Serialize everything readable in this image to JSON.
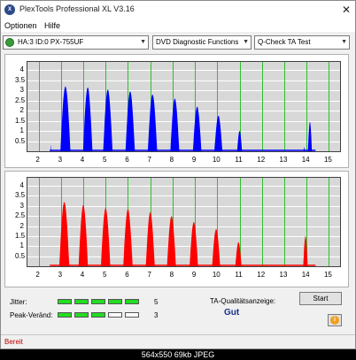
{
  "window": {
    "title": "PlexTools Professional XL V3.16",
    "close_glyph": "✕",
    "icon_text": "X"
  },
  "menu": {
    "items": [
      "Optionen",
      "Hilfe"
    ]
  },
  "toolbar": {
    "drive": "HA:3 ID:0  PX-755UF",
    "function": "DVD Diagnostic Functions",
    "test": "Q-Check TA Test",
    "arrow": "▼"
  },
  "chart_data": [
    {
      "type": "bar",
      "name": "upper",
      "color": "#0000ff",
      "x_ticks": [
        2,
        3,
        4,
        5,
        6,
        7,
        8,
        9,
        10,
        11,
        12,
        13,
        14,
        15
      ],
      "y_ticks": [
        "0.5",
        "1",
        "1.5",
        "2",
        "2.5",
        "3",
        "3.5",
        "4"
      ],
      "xlim": [
        1.5,
        15.5
      ],
      "ylim": [
        0,
        4.4
      ],
      "peaks": [
        {
          "x": 2.55,
          "y": 0.3,
          "w": 0.03
        },
        {
          "x": 3.2,
          "y": 3.2,
          "w": 0.45
        },
        {
          "x": 4.2,
          "y": 3.15,
          "w": 0.42
        },
        {
          "x": 5.1,
          "y": 3.05,
          "w": 0.42
        },
        {
          "x": 6.1,
          "y": 2.95,
          "w": 0.42
        },
        {
          "x": 7.1,
          "y": 2.8,
          "w": 0.42
        },
        {
          "x": 8.1,
          "y": 2.6,
          "w": 0.4
        },
        {
          "x": 9.1,
          "y": 2.2,
          "w": 0.38
        },
        {
          "x": 10.05,
          "y": 1.75,
          "w": 0.36
        },
        {
          "x": 11.0,
          "y": 1.0,
          "w": 0.22
        },
        {
          "x": 13.9,
          "y": 0.2,
          "w": 0.05
        },
        {
          "x": 14.15,
          "y": 1.45,
          "w": 0.18
        }
      ]
    },
    {
      "type": "bar",
      "name": "lower",
      "color": "#ff0000",
      "x_ticks": [
        2,
        3,
        4,
        5,
        6,
        7,
        8,
        9,
        10,
        11,
        12,
        13,
        14,
        15
      ],
      "y_ticks": [
        "0.5",
        "1",
        "1.5",
        "2",
        "2.5",
        "3",
        "3.5",
        "4"
      ],
      "xlim": [
        1.5,
        15.5
      ],
      "ylim": [
        0,
        4.4
      ],
      "peaks": [
        {
          "x": 3.15,
          "y": 3.2,
          "w": 0.45
        },
        {
          "x": 4.0,
          "y": 3.05,
          "w": 0.42
        },
        {
          "x": 5.0,
          "y": 2.9,
          "w": 0.42
        },
        {
          "x": 6.0,
          "y": 2.85,
          "w": 0.42
        },
        {
          "x": 7.0,
          "y": 2.7,
          "w": 0.4
        },
        {
          "x": 7.95,
          "y": 2.5,
          "w": 0.4
        },
        {
          "x": 8.95,
          "y": 2.2,
          "w": 0.38
        },
        {
          "x": 9.95,
          "y": 1.85,
          "w": 0.36
        },
        {
          "x": 10.95,
          "y": 1.2,
          "w": 0.28
        },
        {
          "x": 13.95,
          "y": 1.5,
          "w": 0.2
        }
      ]
    }
  ],
  "metrics": {
    "jitter_label": "Jitter:",
    "jitter_value": "5",
    "jitter_level": 5,
    "peak_label": "Peak-Veränd:",
    "peak_value": "3",
    "peak_level": 3,
    "bar_count": 5,
    "bar_on_color": "#22dd22",
    "bar_off_color": "#ffffff"
  },
  "quality": {
    "label": "TA-Qualitätsanzeige:",
    "value": "Gut"
  },
  "buttons": {
    "start": "Start",
    "info": "i"
  },
  "status": {
    "text": "Bereit"
  },
  "footer": {
    "text": "564x550  69kb  JPEG"
  }
}
